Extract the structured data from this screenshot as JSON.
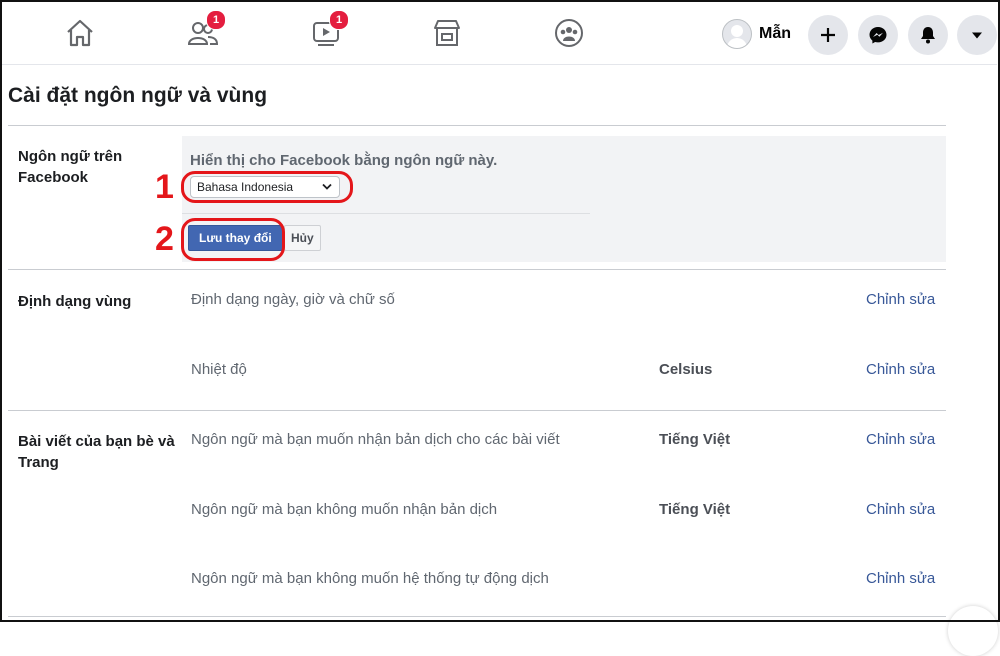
{
  "nav": {
    "friends_badge": "1",
    "watch_badge": "1",
    "profile_name": "Mẫn"
  },
  "page_title": "Cài đặt ngôn ngữ và vùng",
  "language_section": {
    "label": "Ngôn ngữ trên Facebook",
    "description": "Hiển thị cho Facebook bằng ngôn ngữ này.",
    "selected_language": "Bahasa Indonesia",
    "save_label": "Lưu thay đổi",
    "cancel_label": "Hủy",
    "annotation_1": "1",
    "annotation_2": "2"
  },
  "region_section": {
    "label": "Định dạng vùng",
    "rows": [
      {
        "text": "Định dạng ngày, giờ và chữ số",
        "value": "",
        "edit": "Chỉnh sửa"
      },
      {
        "text": "Nhiệt độ",
        "value": "Celsius",
        "edit": "Chỉnh sửa"
      }
    ]
  },
  "posts_section": {
    "label": "Bài viết của bạn bè và Trang",
    "rows": [
      {
        "text": "Ngôn ngữ mà bạn muốn nhận bản dịch cho các bài viết",
        "value": "Tiếng Việt",
        "edit": "Chỉnh sửa"
      },
      {
        "text": "Ngôn ngữ mà bạn không muốn nhận bản dịch",
        "value": "Tiếng Việt",
        "edit": "Chỉnh sửa"
      },
      {
        "text": "Ngôn ngữ mà bạn không muốn hệ thống tự động dịch",
        "value": "",
        "edit": "Chỉnh sửa"
      }
    ]
  },
  "colors": {
    "accent": "#4267b2",
    "link": "#385898",
    "badge": "#e41e3f",
    "annotation": "#e4161a"
  }
}
